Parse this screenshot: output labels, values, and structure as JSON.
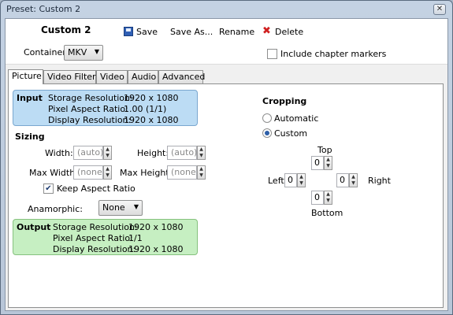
{
  "window": {
    "title": "Preset: Custom 2",
    "close_glyph": "✕"
  },
  "toolbar": {
    "preset_name": "Custom 2",
    "save_label": "Save",
    "save_as_label": "Save As...",
    "rename_label": "Rename",
    "delete_label": "Delete",
    "save_icon": "floppy-disk-icon",
    "delete_icon": "red-x-icon",
    "delete_glyph": "✖"
  },
  "container": {
    "label": "Container:",
    "value": "MKV"
  },
  "chapter_markers": {
    "label": "Include chapter markers",
    "checked": false
  },
  "tabs": [
    {
      "label": "Picture",
      "active": true
    },
    {
      "label": "Video Filters",
      "active": false
    },
    {
      "label": "Video",
      "active": false
    },
    {
      "label": "Audio",
      "active": false
    },
    {
      "label": "Advanced",
      "active": false
    }
  ],
  "input": {
    "heading": "Input",
    "rows": [
      {
        "label": "Storage Resolution:",
        "value": "1920 x 1080"
      },
      {
        "label": "Pixel Aspect Ratio:",
        "value": "1.00 (1/1)"
      },
      {
        "label": "Display Resolution:",
        "value": "1920 x 1080"
      }
    ]
  },
  "sizing": {
    "heading": "Sizing",
    "width_label": "Width:",
    "width_placeholder": "(auto)",
    "height_label": "Height:",
    "height_placeholder": "(auto)",
    "max_width_label": "Max Width:",
    "max_width_placeholder": "(none)",
    "max_height_label": "Max Height:",
    "max_height_placeholder": "(none)",
    "keep_aspect_label": "Keep Aspect Ratio",
    "keep_aspect_checked": true,
    "check_glyph": "✔",
    "anamorphic_label": "Anamorphic:",
    "anamorphic_value": "None"
  },
  "output": {
    "heading": "Output",
    "rows": [
      {
        "label": "Storage Resolution:",
        "value": "1920 x 1080"
      },
      {
        "label": "Pixel Aspect Ratio:",
        "value": "1/1"
      },
      {
        "label": "Display Resolution:",
        "value": "1920 x 1080"
      }
    ]
  },
  "cropping": {
    "heading": "Cropping",
    "automatic_label": "Automatic",
    "custom_label": "Custom",
    "selected": "custom",
    "top_label": "Top",
    "top_value": "0",
    "left_label": "Left",
    "left_value": "0",
    "right_label": "Right",
    "right_value": "0",
    "bottom_label": "Bottom",
    "bottom_value": "0"
  },
  "glyphs": {
    "caret_down": "▼",
    "spin_up": "▲",
    "spin_down": "▼"
  },
  "colors": {
    "input_box_bg": "#bcdcf4",
    "input_box_border": "#7aa7cf",
    "output_box_bg": "#c6efc2",
    "output_box_border": "#86c27e"
  }
}
